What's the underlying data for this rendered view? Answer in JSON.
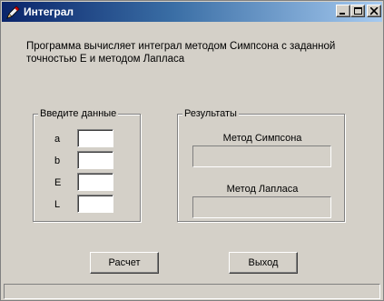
{
  "window": {
    "title": "Интеграл",
    "minimize_icon": "minimize-icon",
    "maximize_icon": "maximize-icon",
    "close_icon": "close-icon",
    "app_icon": "pencil-icon"
  },
  "description": {
    "line1": "Программа вычисляет интеграл методом Симпсона с заданной",
    "line2": "точностью Е и  методом Лапласа"
  },
  "input_group": {
    "title": "Введите данные",
    "fields": [
      {
        "label": "a",
        "value": ""
      },
      {
        "label": "b",
        "value": ""
      },
      {
        "label": "E",
        "value": ""
      },
      {
        "label": "L",
        "value": ""
      }
    ]
  },
  "result_group": {
    "title": "Результаты",
    "simpson_label": "Метод Симпсона",
    "simpson_value": "",
    "laplace_label": "Метод Лапласа",
    "laplace_value": ""
  },
  "buttons": {
    "calculate": "Расчет",
    "exit": "Выход"
  },
  "colors": {
    "face": "#d4d0c8",
    "title_start": "#0a246a",
    "title_end": "#a6caf0"
  }
}
